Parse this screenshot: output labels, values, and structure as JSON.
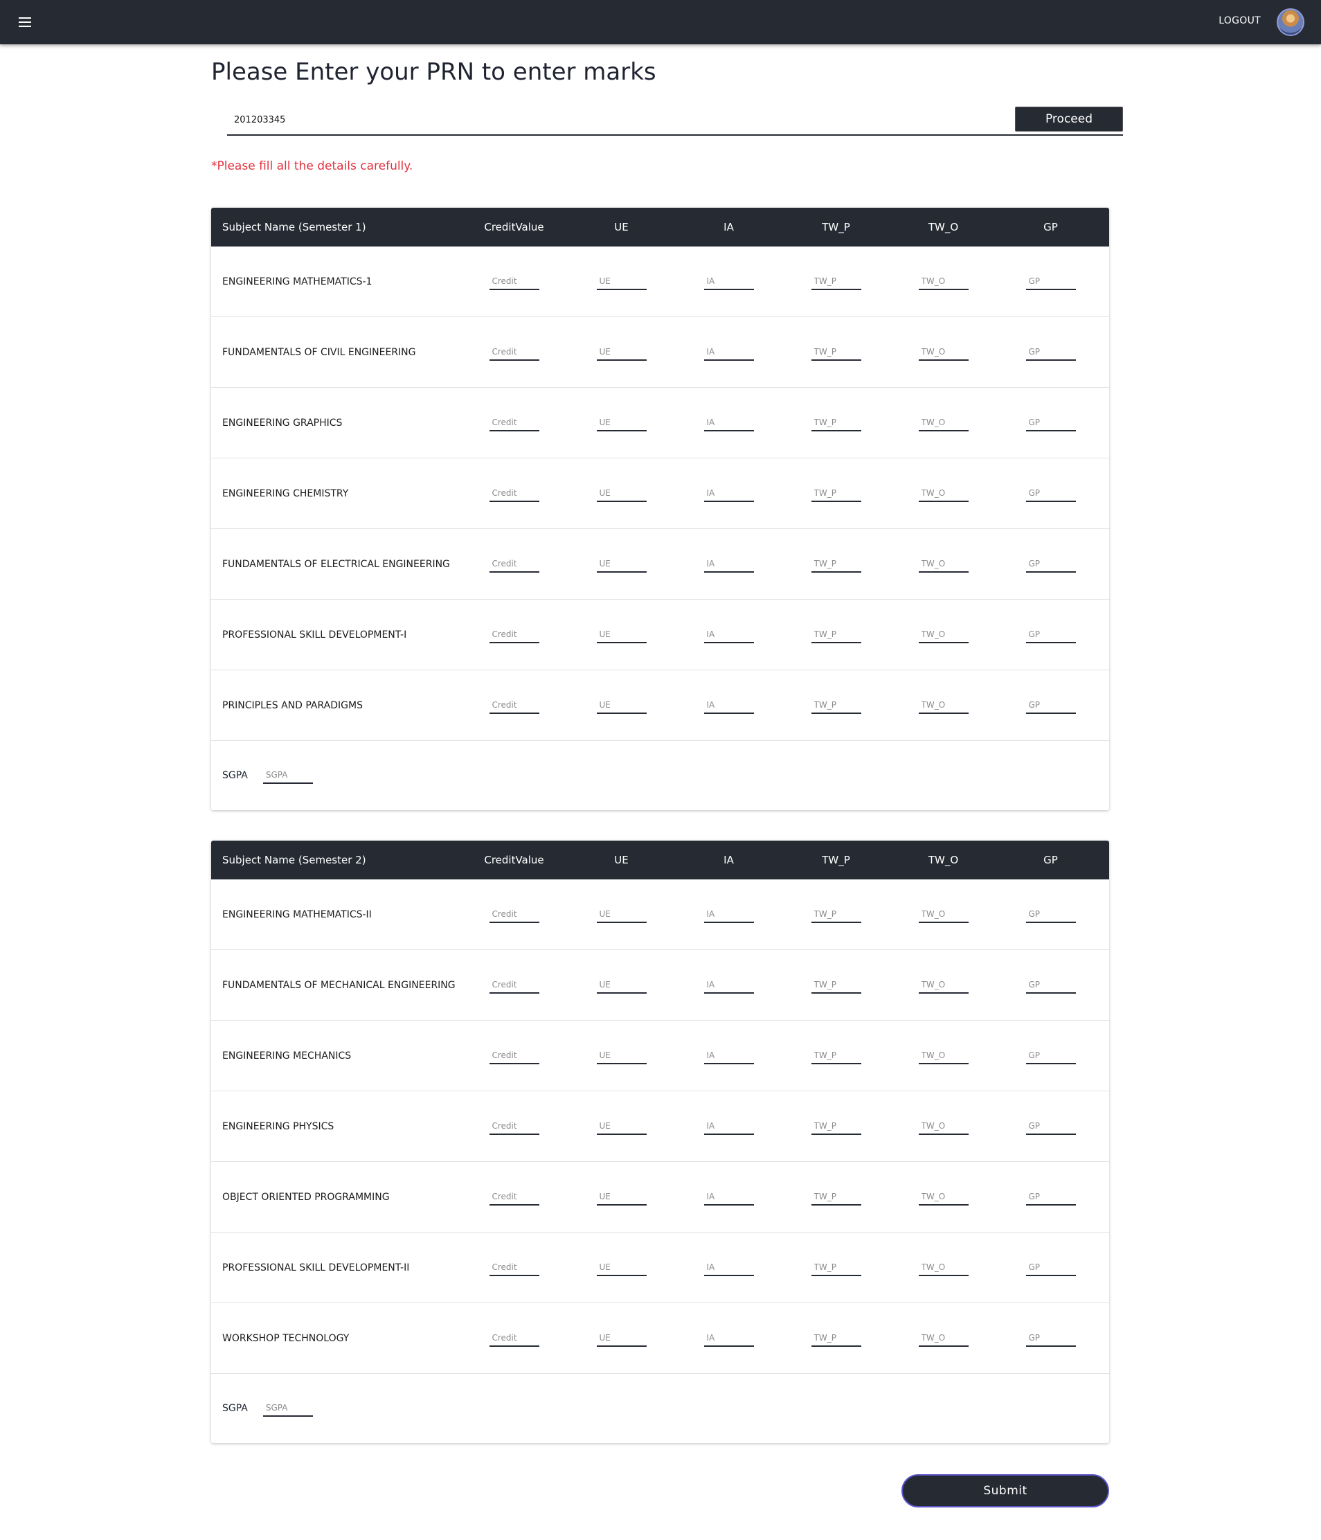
{
  "topbar": {
    "logout_label": "LOGOUT"
  },
  "page_title": "Please Enter your PRN to enter marks",
  "prn": {
    "value": "201203345",
    "proceed_label": "Proceed"
  },
  "notice": "*Please fill all the details carefully.",
  "columns": [
    "CreditValue",
    "UE",
    "IA",
    "TW_P",
    "TW_O",
    "GP"
  ],
  "placeholders": [
    "Credit",
    "UE",
    "IA",
    "TW_P",
    "TW_O",
    "GP"
  ],
  "sgpa": {
    "label": "SGPA",
    "placeholder": "SGPA"
  },
  "semesters": [
    {
      "header": "Subject Name (Semester 1)",
      "subjects": [
        "ENGINEERING MATHEMATICS-1",
        "FUNDAMENTALS OF CIVIL ENGINEERING",
        "ENGINEERING GRAPHICS",
        "ENGINEERING CHEMISTRY",
        "FUNDAMENTALS OF ELECTRICAL ENGINEERING",
        "PROFESSIONAL SKILL DEVELOPMENT-I",
        "PRINCIPLES AND PARADIGMS"
      ]
    },
    {
      "header": "Subject Name (Semester 2)",
      "subjects": [
        "ENGINEERING MATHEMATICS-II",
        "FUNDAMENTALS OF MECHANICAL ENGINEERING",
        "ENGINEERING MECHANICS",
        "ENGINEERING PHYSICS",
        "OBJECT ORIENTED PROGRAMMING",
        "PROFESSIONAL SKILL DEVELOPMENT-II",
        "WORKSHOP TECHNOLOGY"
      ]
    }
  ],
  "submit_label": "Submit"
}
